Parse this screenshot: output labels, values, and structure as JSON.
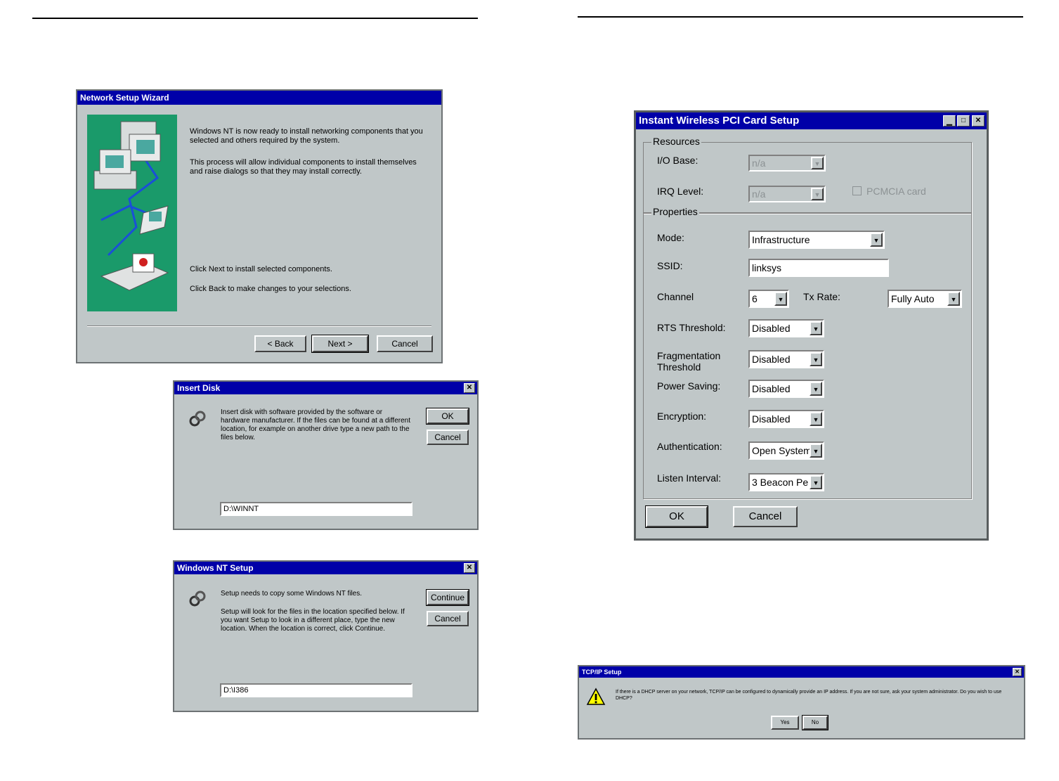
{
  "network_wizard": {
    "title": "Network Setup Wizard",
    "para1": "Windows NT is now ready to install networking components that you selected and others required by the system.",
    "para2": "This process will allow individual components to install themselves and raise dialogs so that they may install correctly.",
    "para3": "Click Next to install selected components.",
    "para4": "Click Back to make changes to your selections.",
    "back_label": "< Back",
    "next_label": "Next >",
    "cancel_label": "Cancel"
  },
  "insert_disk": {
    "title": "Insert Disk",
    "message": "Insert disk with software provided by the software or hardware manufacturer. If the files can be found at a different location, for example on another drive type a new path to the files below.",
    "path_value": "D:\\WINNT",
    "ok_label": "OK",
    "cancel_label": "Cancel"
  },
  "nt_setup": {
    "title": "Windows NT Setup",
    "message1": "Setup needs to copy some Windows NT files.",
    "message2": "Setup will look for the files in the location specified below. If you want Setup to look in a different place, type the new location. When the location is correct, click Continue.",
    "path_value": "D:\\I386",
    "continue_label": "Continue",
    "cancel_label": "Cancel"
  },
  "pci_setup": {
    "title": "Instant Wireless PCI Card Setup",
    "resources_label": "Resources",
    "io_base_label": "I/O Base:",
    "io_base_value": "n/a",
    "irq_label": "IRQ Level:",
    "irq_value": "n/a",
    "pcmcia_label": "PCMCIA card",
    "properties_label": "Properties",
    "mode_label": "Mode:",
    "mode_value": "Infrastructure",
    "ssid_label": "SSID:",
    "ssid_value": "linksys",
    "channel_label": "Channel",
    "channel_value": "6",
    "txrate_label": "Tx Rate:",
    "txrate_value": "Fully Auto",
    "rts_label": "RTS Threshold:",
    "rts_value": "Disabled",
    "frag_label": "Fragmentation Threshold",
    "frag_value": "Disabled",
    "power_label": "Power Saving:",
    "power_value": "Disabled",
    "encryption_label": "Encryption:",
    "encryption_value": "Disabled",
    "auth_label": "Authentication:",
    "auth_value": "Open System",
    "listen_label": "Listen Interval:",
    "listen_value": "3 Beacon Pe",
    "ok_label": "OK",
    "cancel_label": "Cancel"
  },
  "tcpip": {
    "title": "TCP/IP Setup",
    "message": "If there is a DHCP server on your network, TCP/IP can be configured to dynamically provide an IP address. If you are not sure, ask your system administrator. Do you wish to use DHCP?",
    "yes_label": "Yes",
    "no_label": "No"
  }
}
